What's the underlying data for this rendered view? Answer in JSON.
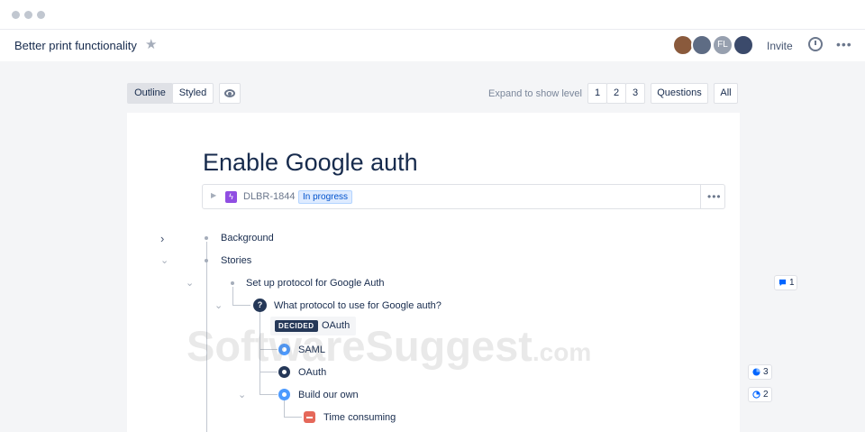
{
  "window": {
    "controls": [
      "close",
      "minimize",
      "maximize"
    ]
  },
  "header": {
    "title": "Better print functionality",
    "avatars": [
      {
        "initials": "",
        "color": "#8a5a3c"
      },
      {
        "initials": "",
        "color": "#5e6c84"
      },
      {
        "initials": "FL",
        "color": "#97a0af"
      },
      {
        "initials": "",
        "color": "#3b4a6b"
      }
    ],
    "invite_label": "Invite",
    "history_icon": "history-icon",
    "more_icon": "more-icon"
  },
  "toolbar": {
    "outline_label": "Outline",
    "styled_label": "Styled",
    "active_view": "Outline",
    "expand_label": "Expand to show level",
    "levels": [
      "1",
      "2",
      "3"
    ],
    "questions_label": "Questions",
    "all_label": "All"
  },
  "document": {
    "title": "Enable Google auth",
    "issue": {
      "key": "DLBR-1844",
      "status": "In progress",
      "icon_color": "#904ee2"
    },
    "outline": {
      "background": "Background",
      "stories": "Stories",
      "story_1": "Set up protocol for Google Auth",
      "question": "What protocol to use for Google auth?",
      "question_icon": "?",
      "decided_badge": "DECIDED",
      "decided_value": "OAuth",
      "option_1": "SAML",
      "option_2": "OAuth",
      "option_3": "Build our own",
      "con_1": "Time consuming"
    },
    "side_badges": {
      "comments": "1",
      "votes": "3",
      "progress": "2"
    }
  },
  "watermark": {
    "main": "SoftwareSuggest",
    "suffix": ".com"
  },
  "colors": {
    "accent_blue": "#4c9aff",
    "dark_navy": "#253858",
    "con_red": "#e5685a",
    "issue_purple": "#904ee2"
  }
}
